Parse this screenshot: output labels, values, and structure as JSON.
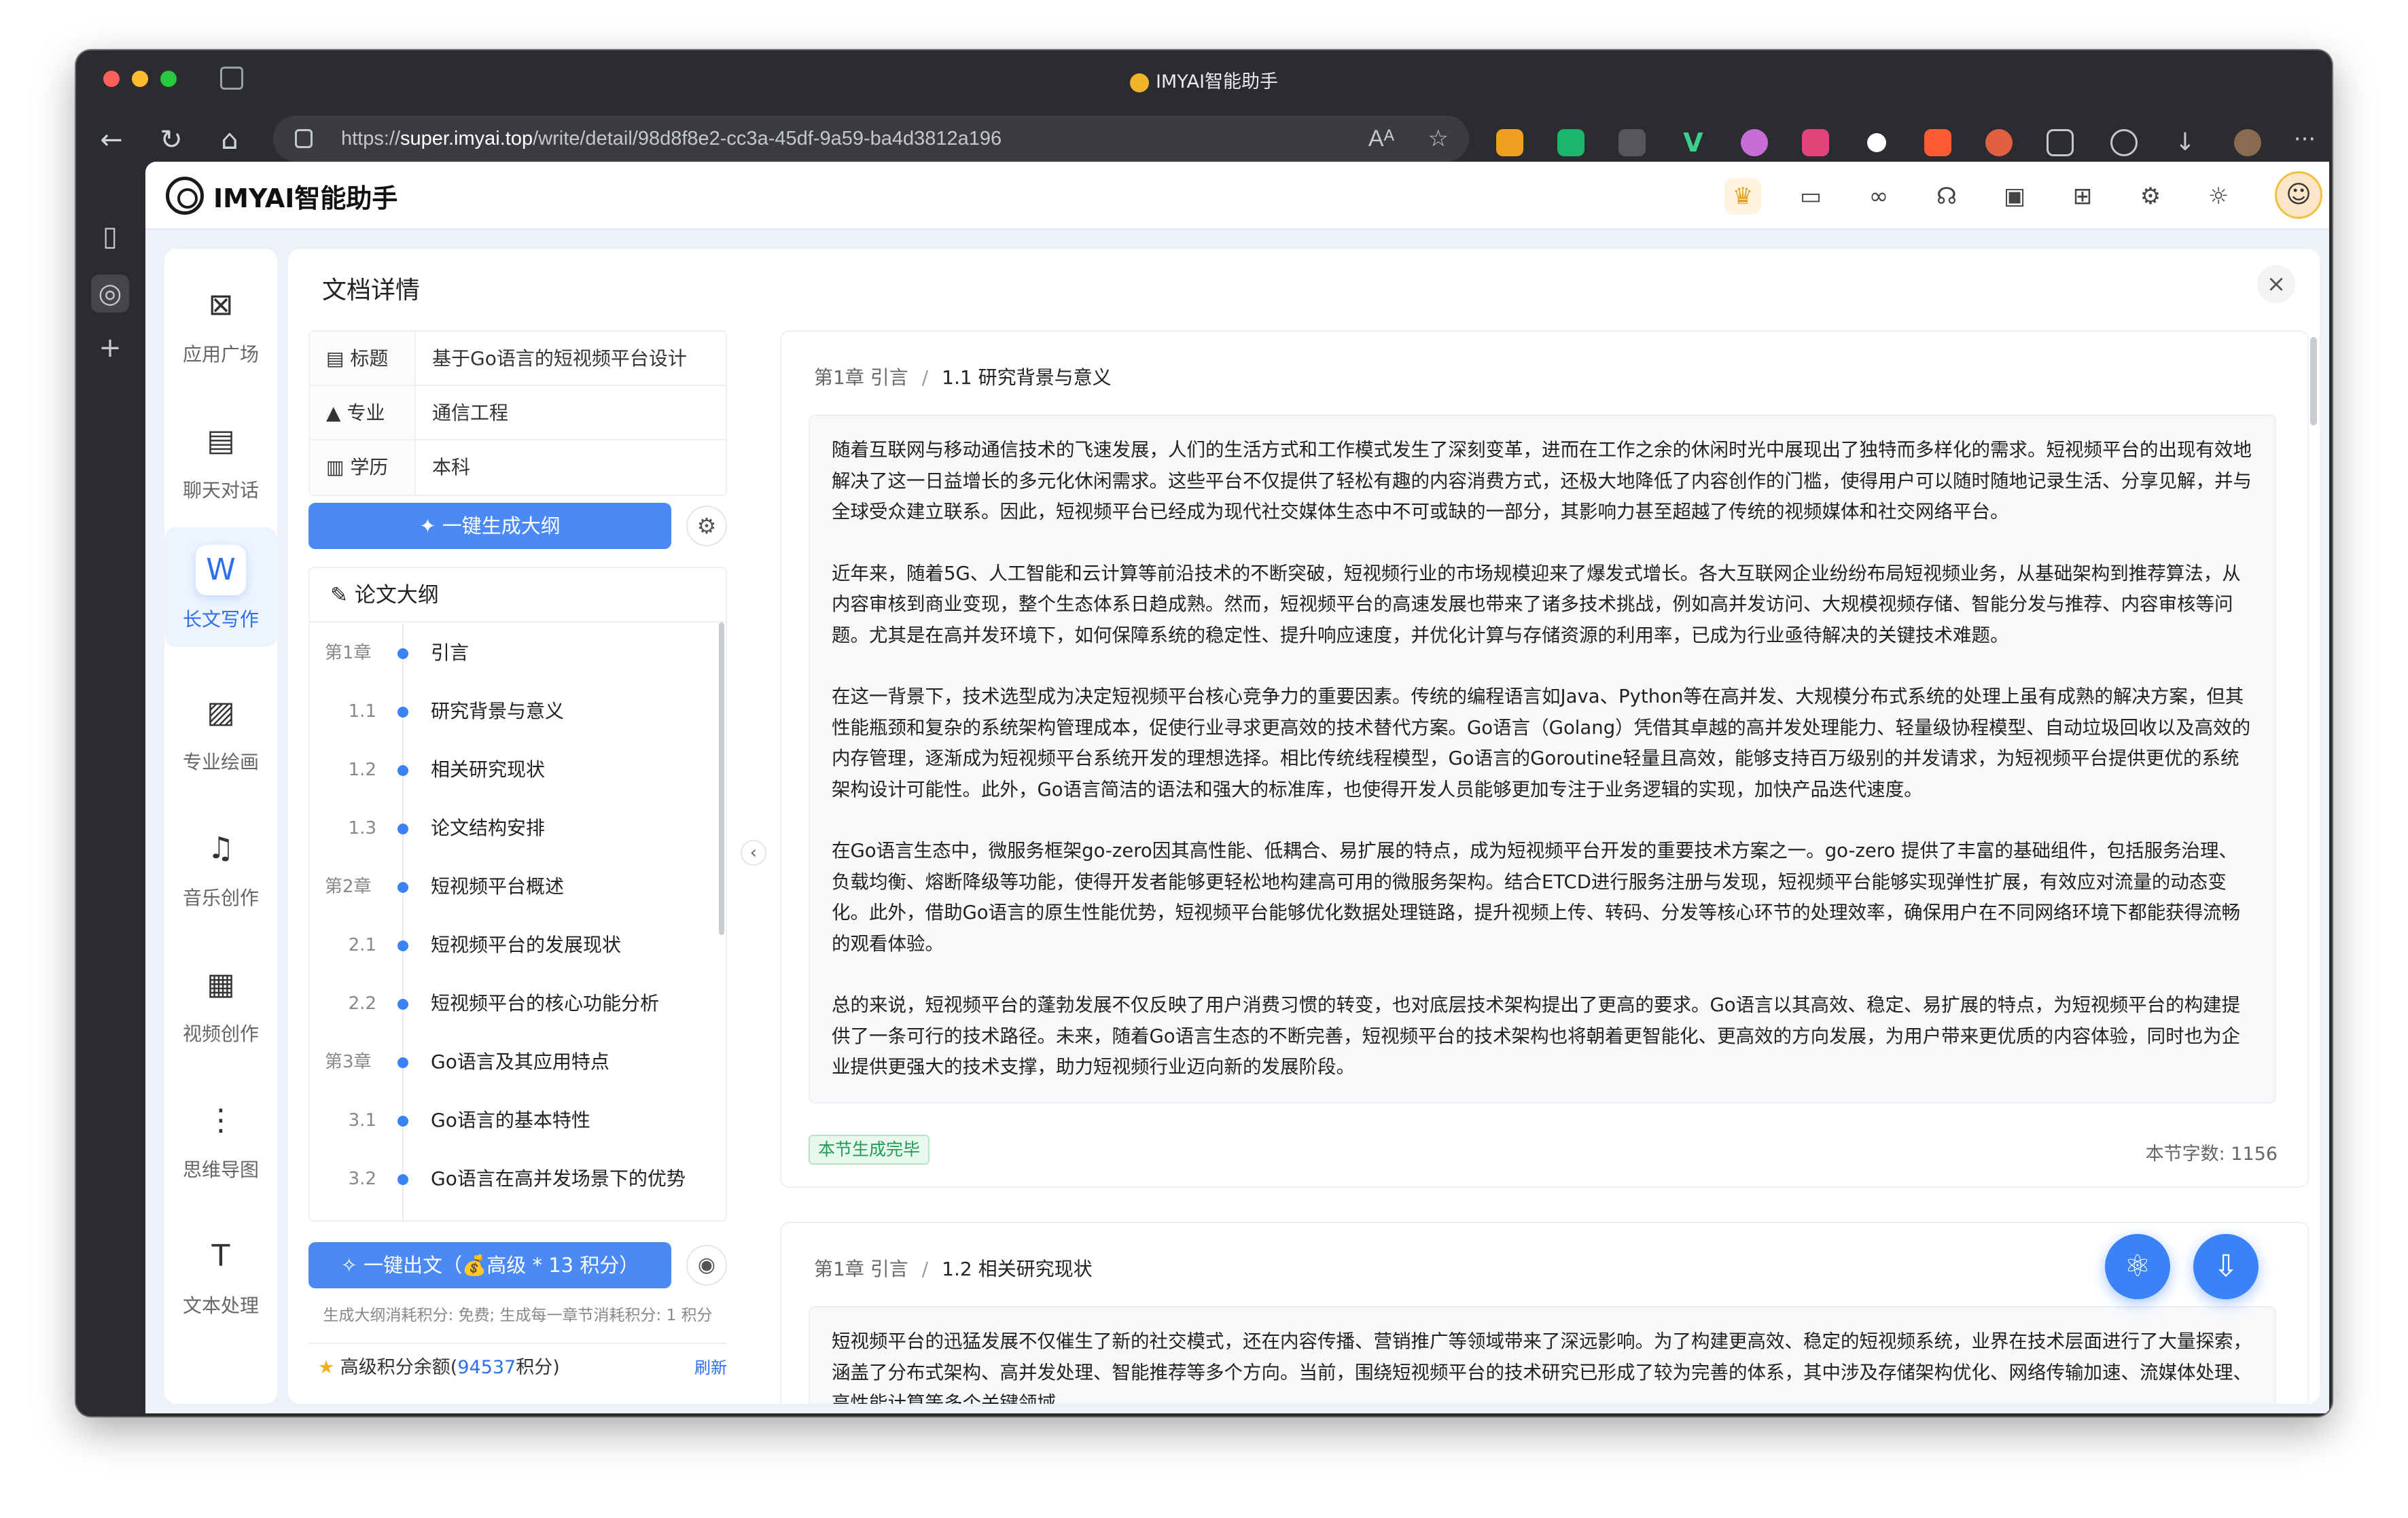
{
  "browser": {
    "window_title": "IMYAI智能助手",
    "url_prefix": "https://",
    "url_host": "super.imyai.top",
    "url_path": "/write/detail/98d8f8e2-cc3a-45df-9a59-ba4d3812a196"
  },
  "app": {
    "brand": "IMYAI智能助手",
    "nav": [
      {
        "label": "应用广场",
        "icon": "app-square-icon"
      },
      {
        "label": "聊天对话",
        "icon": "chat-icon"
      },
      {
        "label": "长文写作",
        "icon": "document-write-icon",
        "active": true
      },
      {
        "label": "专业绘画",
        "icon": "image-icon"
      },
      {
        "label": "音乐创作",
        "icon": "music-note-icon"
      },
      {
        "label": "视频创作",
        "icon": "video-icon"
      },
      {
        "label": "思维导图",
        "icon": "mindmap-icon"
      },
      {
        "label": "文本处理",
        "icon": "text-icon"
      }
    ]
  },
  "panel": {
    "title": "文档详情",
    "meta": [
      {
        "key": "标题",
        "icon": "document-icon",
        "value": "基于Go语言的短视频平台设计"
      },
      {
        "key": "专业",
        "icon": "graduation-cap-icon",
        "value": "通信工程"
      },
      {
        "key": "学历",
        "icon": "books-icon",
        "value": "本科"
      }
    ],
    "generate_outline_button": "一键生成大纲",
    "outline_title": "论文大纲",
    "outline": [
      {
        "num": "第1章",
        "title": "引言",
        "level": 1
      },
      {
        "num": "1.1",
        "title": "研究背景与意义",
        "level": 2
      },
      {
        "num": "1.2",
        "title": "相关研究现状",
        "level": 2
      },
      {
        "num": "1.3",
        "title": "论文结构安排",
        "level": 2
      },
      {
        "num": "第2章",
        "title": "短视频平台概述",
        "level": 1
      },
      {
        "num": "2.1",
        "title": "短视频平台的发展现状",
        "level": 2
      },
      {
        "num": "2.2",
        "title": "短视频平台的核心功能分析",
        "level": 2
      },
      {
        "num": "第3章",
        "title": "Go语言及其应用特点",
        "level": 1
      },
      {
        "num": "3.1",
        "title": "Go语言的基本特性",
        "level": 2
      },
      {
        "num": "3.2",
        "title": "Go语言在高并发场景下的优势",
        "level": 2
      }
    ],
    "write_button": "一键出文（💰高级 * 13 积分）",
    "cost_note": "生成大纲消耗积分: 免费; 生成每一章节消耗积分: 1 积分",
    "balance_prefix": "高级积分余额(",
    "balance_value": "94537",
    "balance_suffix": "积分)",
    "refresh_label": "刷新"
  },
  "sections": [
    {
      "chapter": "第1章 引言",
      "section": "1.1 研究背景与意义",
      "paragraphs": [
        "随着互联网与移动通信技术的飞速发展，人们的生活方式和工作模式发生了深刻变革，进而在工作之余的休闲时光中展现出了独特而多样化的需求。短视频平台的出现有效地解决了这一日益增长的多元化休闲需求。这些平台不仅提供了轻松有趣的内容消费方式，还极大地降低了内容创作的门槛，使得用户可以随时随地记录生活、分享见解，并与全球受众建立联系。因此，短视频平台已经成为现代社交媒体生态中不可或缺的一部分，其影响力甚至超越了传统的视频媒体和社交网络平台。",
        "近年来，随着5G、人工智能和云计算等前沿技术的不断突破，短视频行业的市场规模迎来了爆发式增长。各大互联网企业纷纷布局短视频业务，从基础架构到推荐算法，从内容审核到商业变现，整个生态体系日趋成熟。然而，短视频平台的高速发展也带来了诸多技术挑战，例如高并发访问、大规模视频存储、智能分发与推荐、内容审核等问题。尤其是在高并发环境下，如何保障系统的稳定性、提升响应速度，并优化计算与存储资源的利用率，已成为行业亟待解决的关键技术难题。",
        "在这一背景下，技术选型成为决定短视频平台核心竞争力的重要因素。传统的编程语言如Java、Python等在高并发、大规模分布式系统的处理上虽有成熟的解决方案，但其性能瓶颈和复杂的系统架构管理成本，促使行业寻求更高效的技术替代方案。Go语言（Golang）凭借其卓越的高并发处理能力、轻量级协程模型、自动垃圾回收以及高效的内存管理，逐渐成为短视频平台系统开发的理想选择。相比传统线程模型，Go语言的Goroutine轻量且高效，能够支持百万级别的并发请求，为短视频平台提供更优的系统架构设计可能性。此外，Go语言简洁的语法和强大的标准库，也使得开发人员能够更加专注于业务逻辑的实现，加快产品迭代速度。",
        "在Go语言生态中，微服务框架go-zero因其高性能、低耦合、易扩展的特点，成为短视频平台开发的重要技术方案之一。go-zero 提供了丰富的基础组件，包括服务治理、负载均衡、熔断降级等功能，使得开发者能够更轻松地构建高可用的微服务架构。结合ETCD进行服务注册与发现，短视频平台能够实现弹性扩展，有效应对流量的动态变化。此外，借助Go语言的原生性能优势，短视频平台能够优化数据处理链路，提升视频上传、转码、分发等核心环节的处理效率，确保用户在不同网络环境下都能获得流畅的观看体验。",
        "总的来说，短视频平台的蓬勃发展不仅反映了用户消费习惯的转变，也对底层技术架构提出了更高的要求。Go语言以其高效、稳定、易扩展的特点，为短视频平台的构建提供了一条可行的技术路径。未来，随着Go语言生态的不断完善，短视频平台的技术架构也将朝着更智能化、更高效的方向发展，为用户带来更优质的内容体验，同时也为企业提供更强大的技术支撑，助力短视频行业迈向新的发展阶段。"
      ],
      "status": "本节生成完毕",
      "word_count_label": "本节字数:",
      "word_count": "1156"
    },
    {
      "chapter": "第1章 引言",
      "section": "1.2 相关研究现状",
      "paragraphs": [
        "短视频平台的迅猛发展不仅催生了新的社交模式，还在内容传播、营销推广等领域带来了深远影响。为了构建更高效、稳定的短视频系统，业界在技术层面进行了大量探索，涵盖了分布式架构、高并发处理、智能推荐等多个方向。当前，围绕短视频平台的技术研究已形成了较为完善的体系，其中涉及存储架构优化、网络传输加速、流媒体处理、高性能计算等多个关键领域。"
      ]
    }
  ]
}
